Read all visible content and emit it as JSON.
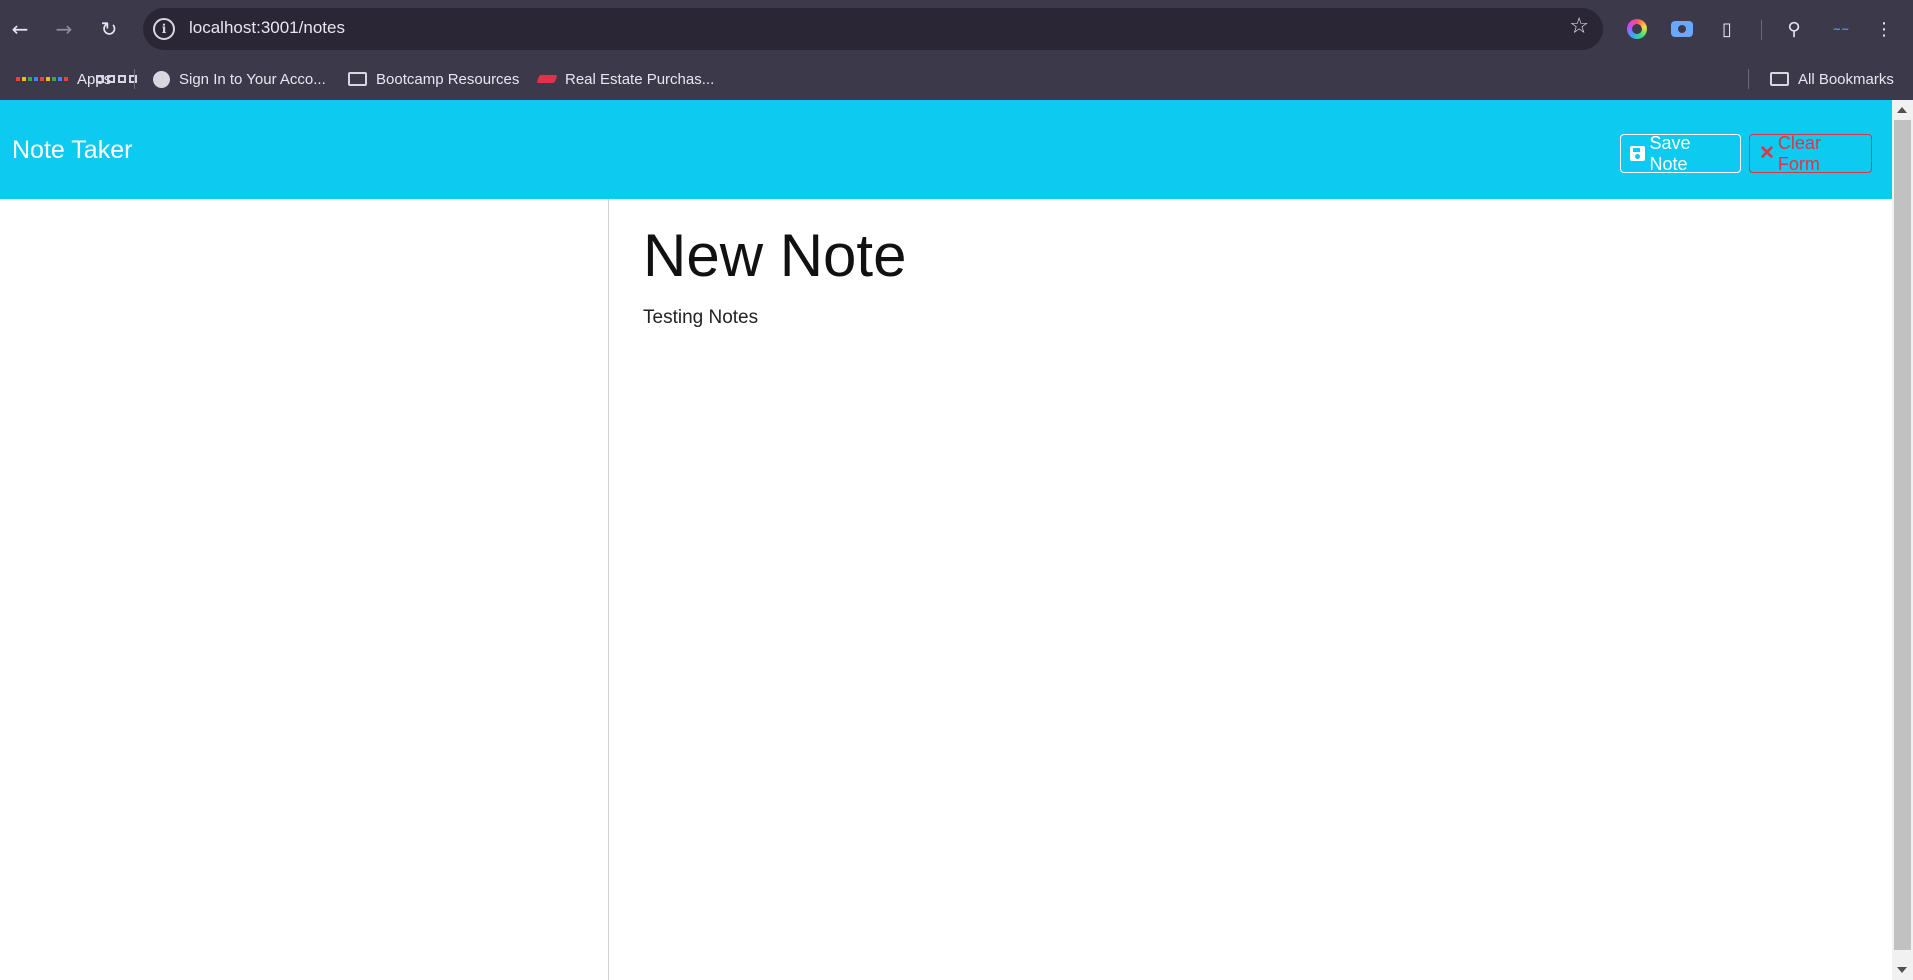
{
  "browser": {
    "url": "localhost:3001/notes",
    "bookmarks": [
      {
        "label": "Apps",
        "icon": "apps-grid-icon"
      },
      {
        "label": "Sign In to Your Acco...",
        "icon": "globe-icon"
      },
      {
        "label": "Bootcamp Resources",
        "icon": "folder-icon"
      },
      {
        "label": "Real Estate Purchas...",
        "icon": "real-estate-icon"
      }
    ],
    "all_bookmarks": "All Bookmarks"
  },
  "navbar": {
    "brand": "Note Taker",
    "save_label": "Save Note",
    "clear_label": "Clear Form",
    "brand_color": "#0dcaf0",
    "danger_color": "#dc3545"
  },
  "editor": {
    "title_value": "New Note",
    "text_value": "Testing Notes"
  }
}
